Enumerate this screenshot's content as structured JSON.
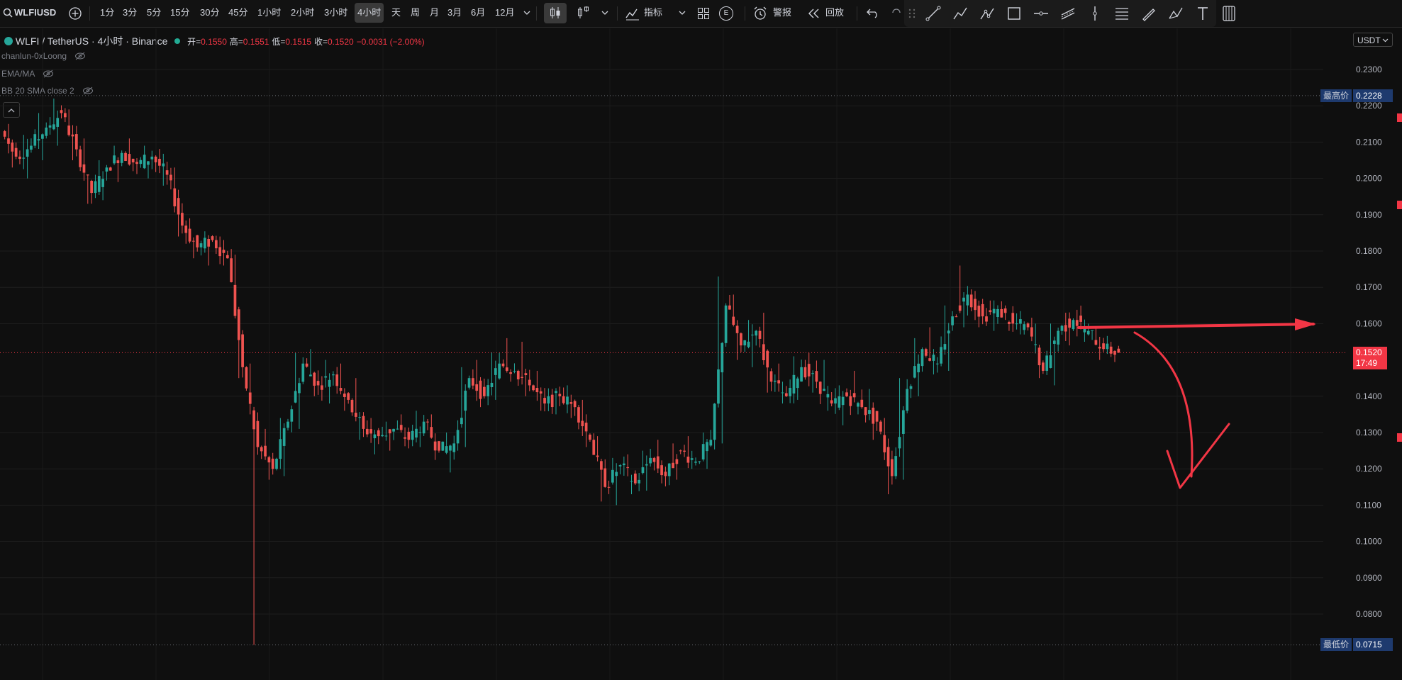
{
  "toolbar": {
    "symbol": "WLFIUSD",
    "intervals": [
      "1分",
      "3分",
      "5分",
      "15分",
      "30分",
      "45分",
      "1小时",
      "2小时",
      "3小时",
      "4小时",
      "天",
      "周",
      "月",
      "3月",
      "6月",
      "12月"
    ],
    "active_interval": "4小时",
    "indicators_label": "指标",
    "e_badge": "E",
    "alert_label": "警报",
    "replay_label": "回放"
  },
  "legend": {
    "title": "WLFI / TetherUS · 4小时 · Binance",
    "open_label": "开=",
    "open": "0.1550",
    "high_label": "高=",
    "high": "0.1551",
    "low_label": "低=",
    "low": "0.1515",
    "close_label": "收=",
    "close": "0.1520",
    "change": "−0.0031 (−2.00%)"
  },
  "indicators": [
    "chanlun-0xLoong",
    "EMA/MA",
    "BB 20 SMA close 2"
  ],
  "price_axis": {
    "currency": "USDT",
    "ticks": [
      "0.2300",
      "0.2200",
      "0.2100",
      "0.2000",
      "0.1900",
      "0.1800",
      "0.1700",
      "0.1600",
      "0.1400",
      "0.1300",
      "0.1200",
      "0.1100",
      "0.1000",
      "0.0900",
      "0.0800"
    ],
    "highest_label": "最高价",
    "highest_value": "0.2228",
    "lowest_label": "最低价",
    "lowest_value": "0.0715",
    "last_price": "0.1520",
    "countdown": "17:49"
  },
  "colors": {
    "up": "#26a69a",
    "down": "#ef5350",
    "annotation": "#f23645",
    "background": "#0f0f0f",
    "tag_bg": "#1e3a6e"
  },
  "chart_data": {
    "type": "candlestick",
    "ylim": [
      0.066,
      0.236
    ],
    "series": [
      {
        "ohlc": [
          [
            0.213,
            0.215,
            0.203,
            0.206
          ],
          [
            0.206,
            0.212,
            0.2,
            0.209
          ],
          [
            0.209,
            0.218,
            0.205,
            0.214
          ],
          [
            0.214,
            0.222,
            0.209,
            0.218
          ],
          [
            0.218,
            0.219,
            0.205,
            0.208
          ],
          [
            0.208,
            0.211,
            0.193,
            0.196
          ],
          [
            0.196,
            0.205,
            0.194,
            0.203
          ],
          [
            0.203,
            0.209,
            0.199,
            0.207
          ],
          [
            0.207,
            0.211,
            0.202,
            0.204
          ],
          [
            0.204,
            0.209,
            0.2,
            0.206
          ],
          [
            0.206,
            0.207,
            0.198,
            0.201
          ],
          [
            0.201,
            0.203,
            0.184,
            0.187
          ],
          [
            0.187,
            0.189,
            0.178,
            0.181
          ],
          [
            0.181,
            0.185,
            0.176,
            0.183
          ],
          [
            0.183,
            0.184,
            0.176,
            0.178
          ],
          [
            0.178,
            0.179,
            0.145,
            0.148
          ],
          [
            0.148,
            0.149,
            0.0715,
            0.126
          ],
          [
            0.126,
            0.131,
            0.117,
            0.12
          ],
          [
            0.12,
            0.134,
            0.118,
            0.133
          ],
          [
            0.133,
            0.152,
            0.131,
            0.149
          ],
          [
            0.149,
            0.153,
            0.14,
            0.143
          ],
          [
            0.143,
            0.15,
            0.138,
            0.146
          ],
          [
            0.146,
            0.149,
            0.136,
            0.139
          ],
          [
            0.139,
            0.145,
            0.128,
            0.131
          ],
          [
            0.131,
            0.134,
            0.124,
            0.129
          ],
          [
            0.129,
            0.133,
            0.125,
            0.131
          ],
          [
            0.131,
            0.135,
            0.127,
            0.128
          ],
          [
            0.128,
            0.136,
            0.126,
            0.133
          ],
          [
            0.133,
            0.135,
            0.123,
            0.125
          ],
          [
            0.125,
            0.13,
            0.119,
            0.127
          ],
          [
            0.127,
            0.148,
            0.126,
            0.145
          ],
          [
            0.145,
            0.15,
            0.137,
            0.14
          ],
          [
            0.14,
            0.152,
            0.139,
            0.149
          ],
          [
            0.149,
            0.156,
            0.144,
            0.147
          ],
          [
            0.147,
            0.155,
            0.14,
            0.143
          ],
          [
            0.143,
            0.147,
            0.136,
            0.138
          ],
          [
            0.138,
            0.142,
            0.135,
            0.14
          ],
          [
            0.14,
            0.143,
            0.134,
            0.137
          ],
          [
            0.137,
            0.139,
            0.126,
            0.128
          ],
          [
            0.128,
            0.129,
            0.111,
            0.115
          ],
          [
            0.115,
            0.123,
            0.11,
            0.121
          ],
          [
            0.121,
            0.124,
            0.113,
            0.116
          ],
          [
            0.116,
            0.125,
            0.114,
            0.123
          ],
          [
            0.123,
            0.128,
            0.116,
            0.118
          ],
          [
            0.118,
            0.127,
            0.117,
            0.125
          ],
          [
            0.125,
            0.129,
            0.12,
            0.122
          ],
          [
            0.122,
            0.13,
            0.12,
            0.128
          ],
          [
            0.128,
            0.173,
            0.127,
            0.165
          ],
          [
            0.165,
            0.168,
            0.15,
            0.154
          ],
          [
            0.154,
            0.161,
            0.148,
            0.158
          ],
          [
            0.158,
            0.163,
            0.141,
            0.144
          ],
          [
            0.144,
            0.149,
            0.138,
            0.14
          ],
          [
            0.14,
            0.151,
            0.139,
            0.148
          ],
          [
            0.148,
            0.152,
            0.141,
            0.144
          ],
          [
            0.144,
            0.15,
            0.136,
            0.138
          ],
          [
            0.138,
            0.143,
            0.132,
            0.14
          ],
          [
            0.14,
            0.147,
            0.135,
            0.137
          ],
          [
            0.137,
            0.142,
            0.128,
            0.133
          ],
          [
            0.133,
            0.134,
            0.113,
            0.118
          ],
          [
            0.118,
            0.145,
            0.117,
            0.142
          ],
          [
            0.142,
            0.156,
            0.14,
            0.153
          ],
          [
            0.153,
            0.159,
            0.146,
            0.149
          ],
          [
            0.149,
            0.165,
            0.147,
            0.162
          ],
          [
            0.162,
            0.176,
            0.159,
            0.168
          ],
          [
            0.168,
            0.169,
            0.159,
            0.162
          ],
          [
            0.162,
            0.166,
            0.158,
            0.164
          ],
          [
            0.164,
            0.165,
            0.158,
            0.16
          ],
          [
            0.16,
            0.162,
            0.157,
            0.159
          ],
          [
            0.159,
            0.16,
            0.145,
            0.147
          ],
          [
            0.147,
            0.16,
            0.143,
            0.158
          ],
          [
            0.158,
            0.163,
            0.154,
            0.161
          ],
          [
            0.161,
            0.162,
            0.155,
            0.158
          ],
          [
            0.158,
            0.159,
            0.15,
            0.153
          ],
          [
            0.153,
            0.155,
            0.15,
            0.152
          ]
        ]
      }
    ]
  }
}
